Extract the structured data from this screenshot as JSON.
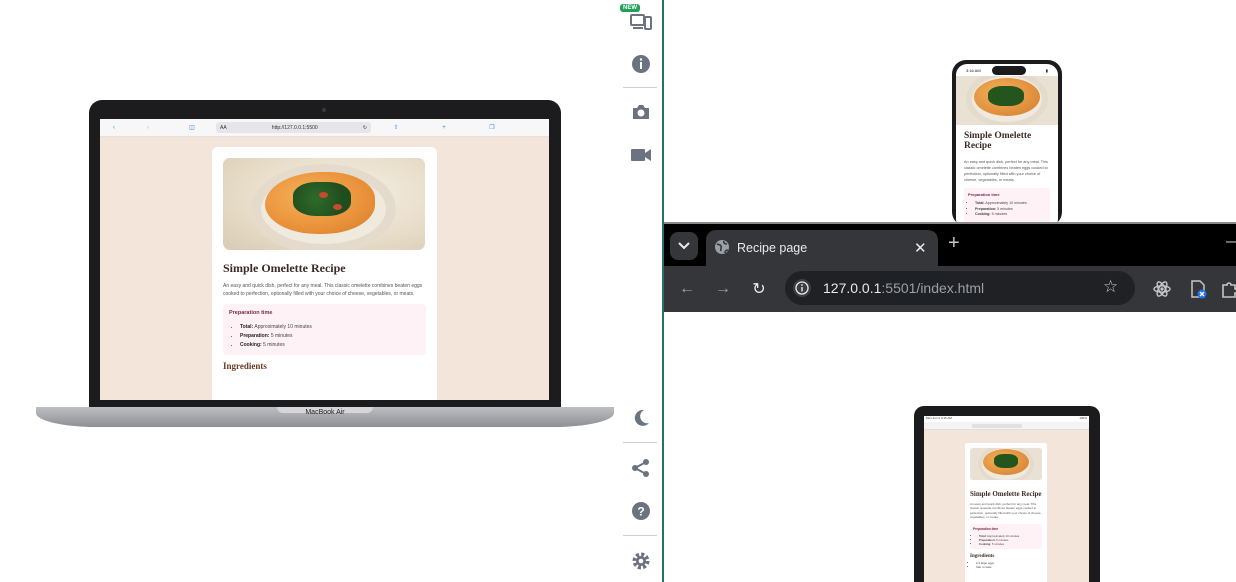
{
  "laptop": {
    "model_label": "MacBook Air",
    "safari": {
      "text_size": "AA",
      "url": "http://127.0.0.1:5500"
    }
  },
  "recipe": {
    "title": "Simple Omelette Recipe",
    "description": "An easy and quick dish, perfect for any meal. This classic omelette combines beaten eggs cooked to perfection, optionally filled with your choice of cheese, vegetables, or meats.",
    "prep_title": "Preparation time",
    "prep_items": [
      {
        "label": "Total:",
        "value": " Approximately 10 minutes"
      },
      {
        "label": "Preparation:",
        "value": " 5 minutes"
      },
      {
        "label": "Cooking:",
        "value": " 5 minutes"
      }
    ],
    "ingredients_title": "Ingredients",
    "ingredients": [
      "2-3 large eggs",
      "Salt, to taste"
    ]
  },
  "toolbar": {
    "new_badge": "NEW",
    "icons": [
      "devices-icon",
      "info-icon",
      "camera-icon",
      "video-icon",
      "dark-mode-icon",
      "share-icon",
      "help-icon",
      "settings-icon"
    ]
  },
  "phone": {
    "time": "3:16 AM",
    "title": "Simple Omelette Recipe"
  },
  "chrome": {
    "tab_title": "Recipe page",
    "url_host": "127.0.0.1",
    "url_rest": ":5501/index.html"
  },
  "tablet": {
    "status_left": "Mon Jun 2  3:16 AM",
    "status_right": "100%"
  },
  "colors": {
    "toolbar_divider": "#2b6f6a",
    "page_background": "#f3e5d9",
    "prep_background": "#fff2f7",
    "new_badge": "#22a05a"
  }
}
